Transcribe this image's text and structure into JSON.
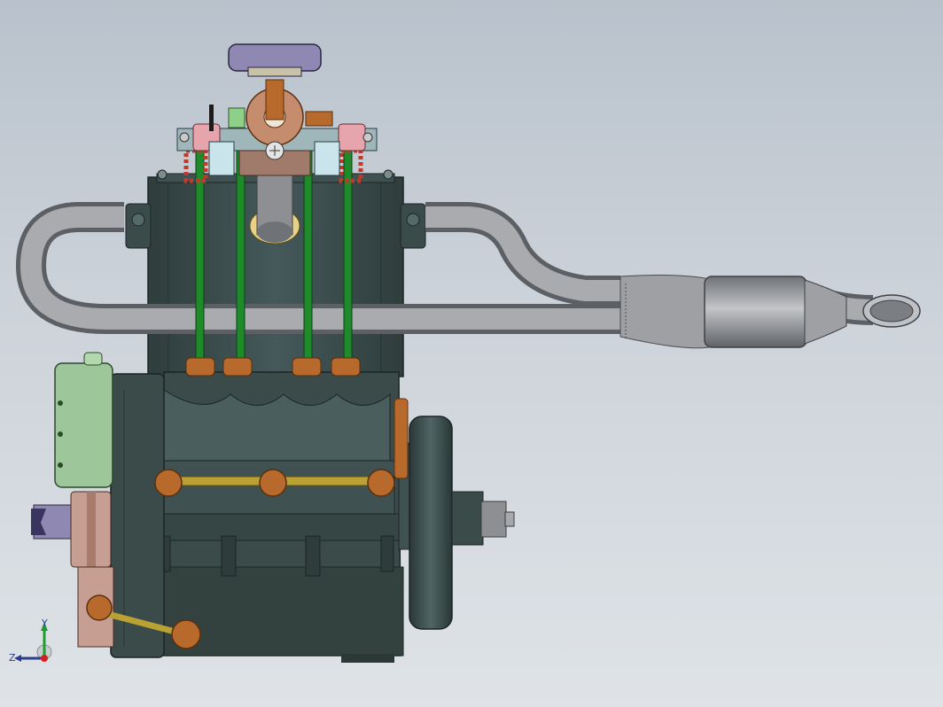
{
  "viewport": {
    "background_top": "#b9c2cc",
    "background_bottom": "#dfe3e7"
  },
  "model": {
    "colors": {
      "engine_body": "#3b4b4a",
      "engine_body_dark": "#263332",
      "exhaust": "#8d8f92",
      "pushrod": "#1f8a2a",
      "spring": "#c0392b",
      "bronze": "#b86a2c",
      "distributor_cap": "#8f88b2",
      "timing_cover": "#9dc79a",
      "brass_rod": "#b9a233"
    }
  },
  "triad": {
    "y_label": "Y",
    "z_label": "Z",
    "x_color": "#d42020",
    "y_color": "#1d9e2a",
    "z_color": "#2b3d8c"
  }
}
